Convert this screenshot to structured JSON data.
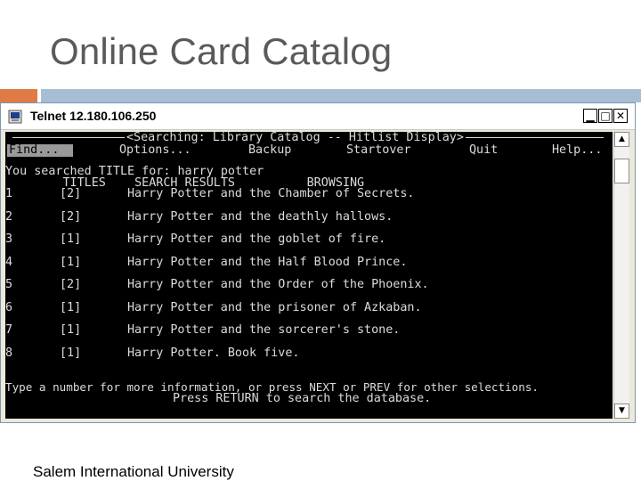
{
  "slide": {
    "title": "Online Card Catalog",
    "footer": "Salem International University"
  },
  "window": {
    "title": "Telnet 12.180.106.250",
    "controls": {
      "minimize": "▁",
      "maximize": "□",
      "close": "✕"
    }
  },
  "console": {
    "header_line": "<Searching: Library Catalog -- Hitlist Display>",
    "menu": {
      "find": "Find...",
      "options": "Options...",
      "backup": "Backup",
      "startover": "Startover",
      "quit": "Quit",
      "help": "Help..."
    },
    "search_line": "You searched TITLE for: harry potter",
    "columns_line": "        TITLES    SEARCH RESULTS          BROWSING",
    "results": [
      {
        "num": "1",
        "count": "[2]",
        "title": "Harry Potter and the Chamber of Secrets."
      },
      {
        "num": "2",
        "count": "[2]",
        "title": "Harry Potter and the deathly hallows."
      },
      {
        "num": "3",
        "count": "[1]",
        "title": "Harry Potter and the goblet of fire."
      },
      {
        "num": "4",
        "count": "[1]",
        "title": "Harry Potter and the Half Blood Prince."
      },
      {
        "num": "5",
        "count": "[2]",
        "title": "Harry Potter and the Order of the Phoenix."
      },
      {
        "num": "6",
        "count": "[1]",
        "title": "Harry Potter and the prisoner of Azkaban."
      },
      {
        "num": "7",
        "count": "[1]",
        "title": "Harry Potter and the sorcerer's stone."
      },
      {
        "num": "8",
        "count": "[1]",
        "title": "Harry Potter. Book five."
      }
    ],
    "prompt_line1": "Type a number for more information, or press NEXT or PREV for other selections.",
    "prompt_line2": "Press RETURN to search the database."
  },
  "scrollbar": {
    "up_icon": "▲",
    "down_icon": "▼"
  },
  "colors": {
    "accent_orange": "#e07b46",
    "accent_blue": "#a7bdd3",
    "console_bg": "#000000",
    "console_text": "#dcdcdc"
  }
}
